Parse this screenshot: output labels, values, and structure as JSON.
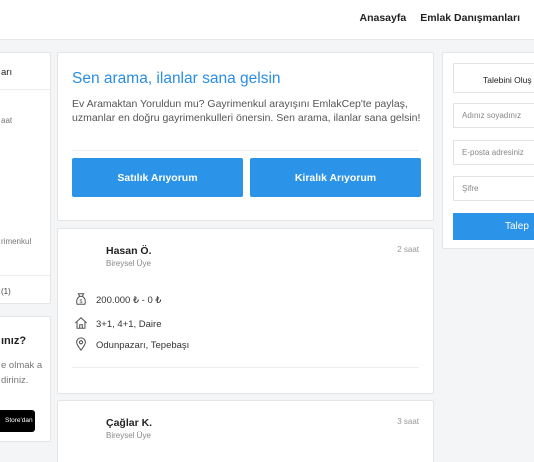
{
  "nav": {
    "home": "Anasayfa",
    "consultants": "Emlak Danışmanları"
  },
  "left_panel": {
    "header": "arı",
    "line1": "aat",
    "line2": "rimenkul",
    "footer": "(1)"
  },
  "left_promo": {
    "question": "ınız?",
    "desc": "e olmak a diriniz.",
    "store": "Store'dan"
  },
  "hero": {
    "title": "Sen arama, ilanlar sana gelsin",
    "description": "Ev Aramaktan Yoruldun mu? Gayrimenkul arayışını EmlakCep'te paylaş, uzmanlar en doğru gayrimenkulleri önersin. Sen arama, ilanlar sana gelsin!",
    "btn_sale": "Satılık Arıyorum",
    "btn_rent": "Kiralık Arıyorum"
  },
  "listings": [
    {
      "name": "Hasan Ö.",
      "role": "Bireysel Üye",
      "time": "2 saat",
      "price": "200.000 ₺ - 0 ₺",
      "rooms": "3+1, 4+1, Daire",
      "location": "Odunpazarı, Tepebaşı"
    },
    {
      "name": "Çağlar K.",
      "role": "Bireysel Üye",
      "time": "3 saat"
    }
  ],
  "form": {
    "tab_label": "Talebini Oluş",
    "name_placeholder": "Adınız soyadınız",
    "email_placeholder": "E-posta adresiniz",
    "password_placeholder": "Şifre",
    "submit_label": "Talep"
  },
  "colors": {
    "accent": "#2b93e8",
    "title_blue": "#2b8ee2",
    "page_bg": "#f4f5f7"
  }
}
